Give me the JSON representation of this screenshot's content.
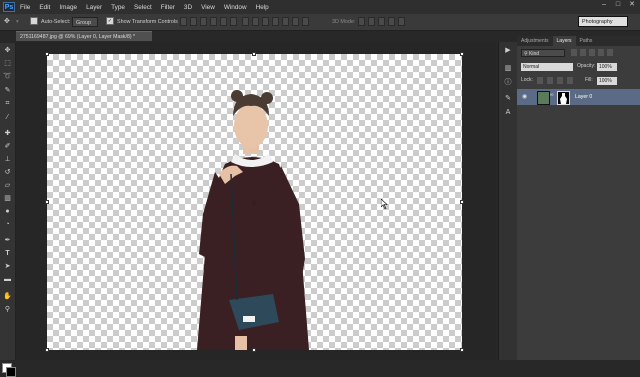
{
  "app": {
    "logo": "Ps",
    "menu": [
      "File",
      "Edit",
      "Image",
      "Layer",
      "Type",
      "Select",
      "Filter",
      "3D",
      "View",
      "Window",
      "Help"
    ],
    "window_controls": [
      "–",
      "□",
      "✕"
    ]
  },
  "options_bar": {
    "auto_select_label": "Auto-Select:",
    "auto_select_target": "Group",
    "show_transform_label": "Show Transform Controls",
    "mode_label": "3D Mode:",
    "workspace": "Photography"
  },
  "document": {
    "tab_title": "2751169487.jpg @ 69% (Layer 0, Layer Mask/8) *"
  },
  "layers_panel": {
    "tabs": [
      "Adjustments",
      "Layers",
      "Paths"
    ],
    "active_tab": "Layers",
    "kind_label": "Kind",
    "blend_mode": "Normal",
    "opacity_label": "Opacity:",
    "opacity_value": "100%",
    "lock_label": "Lock:",
    "fill_label": "Fill:",
    "fill_value": "100%",
    "layers": [
      {
        "name": "Layer 0",
        "visible": true,
        "has_mask": true,
        "selected": true
      }
    ]
  },
  "colors": {
    "foreground": "#ffffff",
    "background": "#000000",
    "selected_layer": "#5b6a85"
  }
}
